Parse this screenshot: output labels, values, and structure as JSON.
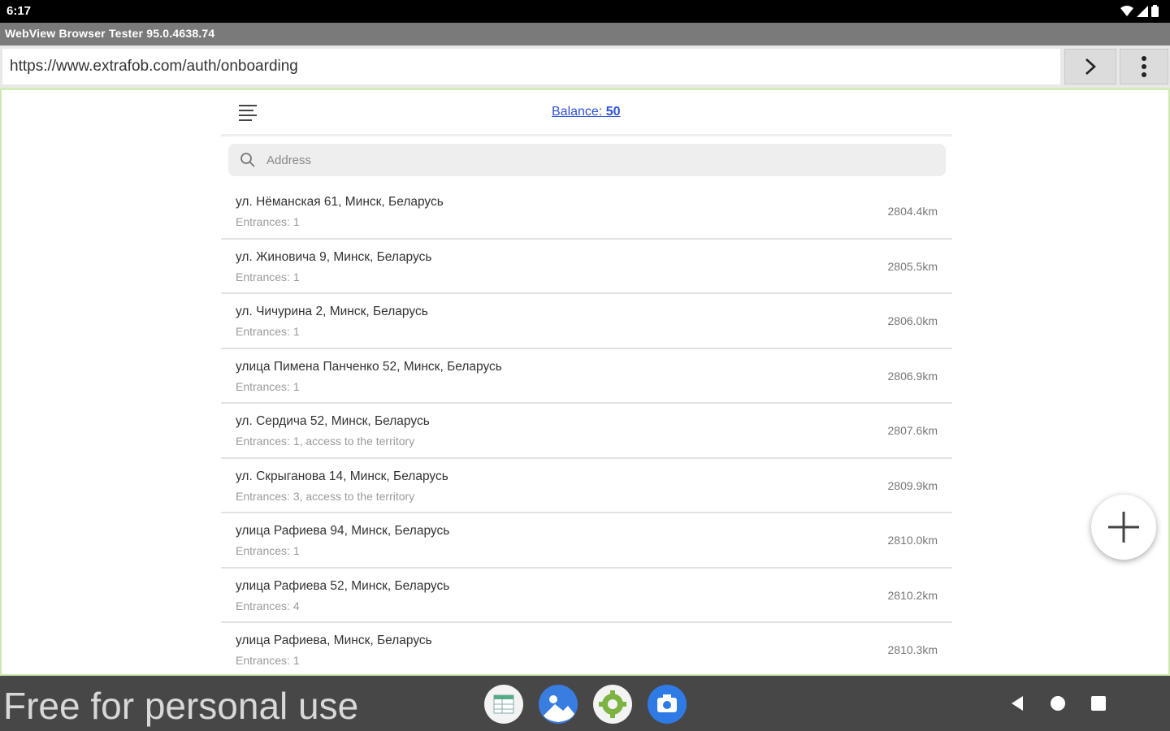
{
  "status_bar": {
    "time": "6:17"
  },
  "app": {
    "title": "WebView Browser Tester 95.0.4638.74"
  },
  "url_bar": {
    "url": "https://www.extrafob.com/auth/onboarding"
  },
  "header": {
    "balance_label": "Balance:",
    "balance_value": "50"
  },
  "search": {
    "placeholder": "Address"
  },
  "addresses": [
    {
      "title": "ул. Нёманская 61, Минск, Беларусь",
      "subtitle": "Entrances: 1",
      "distance": "2804.4km"
    },
    {
      "title": "ул. Жиновича 9, Минск, Беларусь",
      "subtitle": "Entrances: 1",
      "distance": "2805.5km"
    },
    {
      "title": "ул. Чичурина 2, Минск, Беларусь",
      "subtitle": "Entrances: 1",
      "distance": "2806.0km"
    },
    {
      "title": "улица Пимена Панченко 52, Минск, Беларусь",
      "subtitle": "Entrances: 1",
      "distance": "2806.9km"
    },
    {
      "title": "ул. Сердича 52, Минск, Беларусь",
      "subtitle": "Entrances: 1, access to the territory",
      "distance": "2807.6km"
    },
    {
      "title": "ул. Скрыганова 14, Минск, Беларусь",
      "subtitle": "Entrances: 3, access to the territory",
      "distance": "2809.9km"
    },
    {
      "title": "улица Рафиева 94, Минск, Беларусь",
      "subtitle": "Entrances: 1",
      "distance": "2810.0km"
    },
    {
      "title": "улица Рафиева 52, Минск, Беларусь",
      "subtitle": "Entrances: 4",
      "distance": "2810.2km"
    },
    {
      "title": "улица Рафиева, Минск, Беларусь",
      "subtitle": "Entrances: 1",
      "distance": "2810.3km"
    }
  ],
  "watermark": "Free for personal use",
  "dock": {
    "apps": [
      "sheets-app-icon",
      "photos-app-icon",
      "android-settings-app-icon",
      "camera-app-icon"
    ]
  },
  "colors": {
    "link": "#2b4fd6",
    "nav_bar": "#474747",
    "content_border": "#cfe8b0"
  }
}
